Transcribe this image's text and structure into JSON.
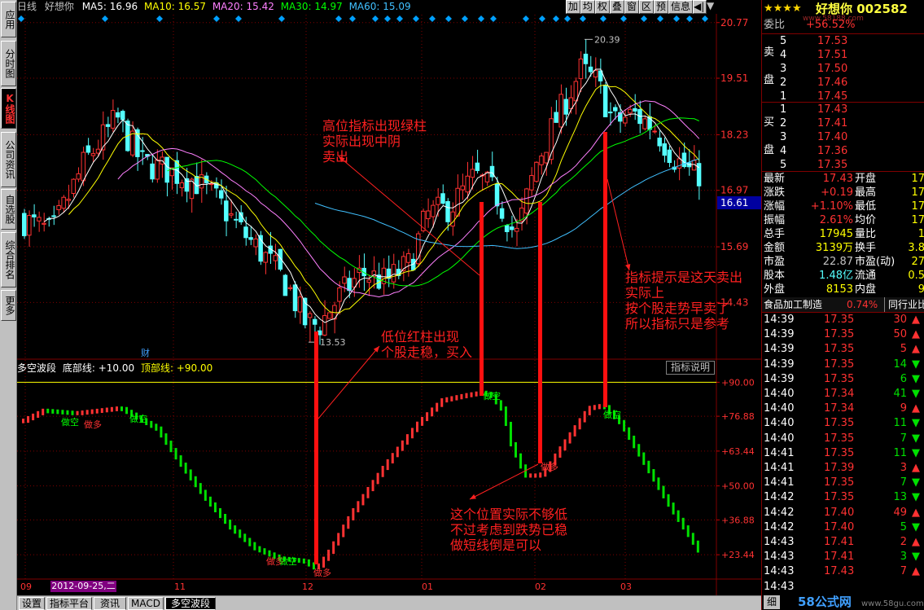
{
  "left_tabs": [
    "应用",
    "分时图",
    "K线图",
    "公司资讯",
    "自选股",
    "综合排名",
    "更多"
  ],
  "kline": {
    "period": "日线",
    "stock_name": "好想你",
    "ma5": "MA5: 16.96",
    "ma10": "MA10: 16.57",
    "ma20": "MA20: 15.42",
    "ma30": "MA30: 14.97",
    "ma60": "MA60: 15.09",
    "high_marker": "20.39",
    "low_marker": "13.53",
    "cai_marker": "财",
    "last_price_tag": "16.61"
  },
  "toolbar": [
    "加",
    "均",
    "权",
    "叠",
    "窗",
    "区",
    "预",
    "信息"
  ],
  "price_axis": [
    "20.77",
    "19.51",
    "18.23",
    "16.97",
    "15.69",
    "14.43"
  ],
  "indicator": {
    "name": "多空波段",
    "bottom_line": "底部线: +10.00",
    "top_line": "顶部线: +90.00",
    "explain_button": "指标说明",
    "axis": [
      "+90.00",
      "+76.88",
      "+63.44",
      "+50.00",
      "+36.88",
      "+23.44"
    ],
    "labels": {
      "zuokong": "做空",
      "zuoduo": "做多"
    }
  },
  "time_axis": {
    "date_badge": "2012-09-25,二",
    "ticks": [
      "09",
      "11",
      "12",
      "01",
      "02",
      "03"
    ]
  },
  "bottom_tabs": [
    "设置",
    "指标平台",
    "资讯",
    "MACD",
    "多空波段"
  ],
  "annotations": {
    "a1": [
      "高位指标出现绿柱",
      "实际出现中阴",
      "卖出"
    ],
    "a2": [
      "低位红柱出现",
      "个股走稳，买入"
    ],
    "a3": [
      "指标提示是这天卖出",
      "实际上",
      "按个股走势早卖了",
      "所以指标只是参考"
    ],
    "a4": [
      "这个位置实际不够低",
      "不过考虑到跌势已稳",
      "做短线倒是可以"
    ]
  },
  "quote": {
    "stars": "★★★★",
    "title": "好想你 002582",
    "watermark": "www.58188.com",
    "weibi_label": "委比",
    "weibi_value": "+56.52%",
    "sell_label": [
      "卖",
      "盘"
    ],
    "buy_label": [
      "买",
      "盘"
    ],
    "sell": [
      [
        "5",
        "17.53"
      ],
      [
        "4",
        "17.51"
      ],
      [
        "3",
        "17.50"
      ],
      [
        "2",
        "17.46"
      ],
      [
        "1",
        "17.45"
      ]
    ],
    "buy": [
      [
        "1",
        "17.43"
      ],
      [
        "2",
        "17.41"
      ],
      [
        "3",
        "17.40"
      ],
      [
        "4",
        "17.36"
      ],
      [
        "5",
        "17.35"
      ]
    ],
    "stats": [
      [
        "最新",
        "17.43",
        "开盘",
        "17"
      ],
      [
        "涨跌",
        "+0.19",
        "最高",
        "17"
      ],
      [
        "涨幅",
        "+1.10%",
        "最低",
        "17"
      ],
      [
        "振幅",
        "2.61%",
        "均价",
        "17"
      ],
      [
        "总手",
        "17945",
        "量比",
        "1"
      ],
      [
        "金额",
        "3139万",
        "换手",
        "3.8"
      ],
      [
        "市盈",
        "22.87",
        "市盈(动)",
        "27"
      ],
      [
        "股本",
        "1.48亿",
        "流通",
        "0.5"
      ],
      [
        "外盘",
        "8153",
        "内盘",
        "9"
      ]
    ],
    "industry": "食品加工制造",
    "industry_change": "0.74%",
    "industry_rank": "同行业比",
    "ticks": [
      [
        "14:39",
        "17.35",
        "30",
        "up"
      ],
      [
        "14:39",
        "17.35",
        "50",
        "up"
      ],
      [
        "14:39",
        "17.35",
        "5",
        "up"
      ],
      [
        "14:39",
        "17.35",
        "14",
        "down"
      ],
      [
        "14:39",
        "17.35",
        "6",
        "down"
      ],
      [
        "14:40",
        "17.34",
        "41",
        "down"
      ],
      [
        "14:40",
        "17.34",
        "9",
        "up"
      ],
      [
        "14:40",
        "17.35",
        "11",
        "down"
      ],
      [
        "14:40",
        "17.35",
        "7",
        "down"
      ],
      [
        "14:41",
        "17.35",
        "11",
        "down"
      ],
      [
        "14:41",
        "17.39",
        "3",
        "up"
      ],
      [
        "14:41",
        "17.35",
        "7",
        "down"
      ],
      [
        "14:42",
        "17.35",
        "13",
        "down"
      ],
      [
        "14:42",
        "17.40",
        "49",
        "up"
      ],
      [
        "14:42",
        "17.40",
        "5",
        "down"
      ],
      [
        "14:43",
        "17.41",
        "2",
        "up"
      ],
      [
        "14:43",
        "17.41",
        "3",
        "down"
      ],
      [
        "14:43",
        "17.43",
        "7",
        "up"
      ],
      [
        "14:43",
        "",
        "",
        ""
      ]
    ],
    "footer_left": "细",
    "footer_logo": "58公式网",
    "footer_site": "www.58gu.com"
  },
  "colors": {
    "up": "#ff3232",
    "down": "#54ffff",
    "vol_green": "#00e000",
    "ma5": "#ffffff",
    "ma10": "#ffff00",
    "ma20": "#ff80ff",
    "ma30": "#00ff00",
    "ma60": "#40c0ff",
    "grid": "#800000",
    "annotation": "#ff2020"
  }
}
